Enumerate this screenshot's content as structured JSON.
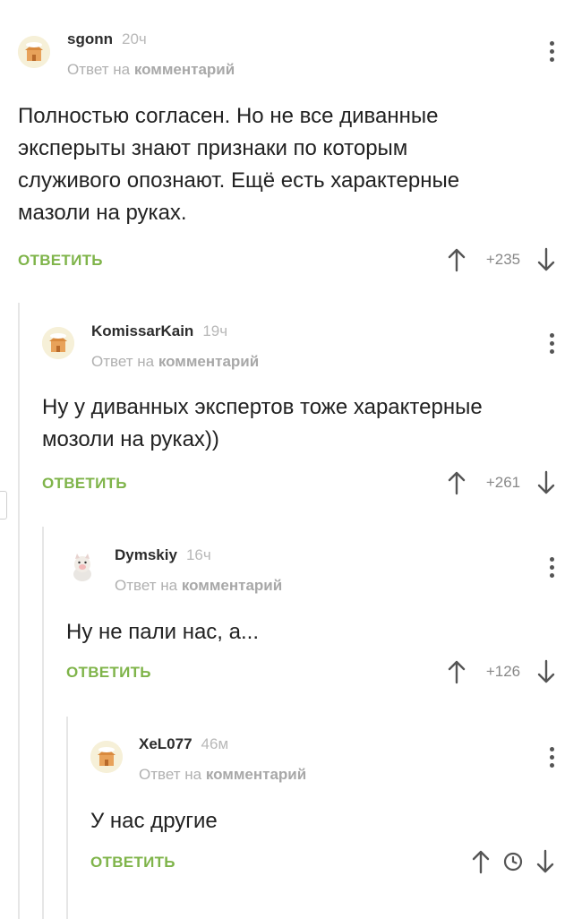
{
  "reply_label": "ОТВЕТИТЬ",
  "reply_to": {
    "prefix": "Ответ на",
    "target": "комментарий"
  },
  "colors": {
    "accent": "#7fb44a",
    "muted": "#b0b0b0",
    "text": "#222222"
  },
  "comments": [
    {
      "author": "sgonn",
      "time": "20ч",
      "avatar": "default-house-avatar",
      "text": "Полностью согласен. Но не все диванные\nэксперыты знают признаки по которым\nслуживого опознают. Ещё есть характерные\nмазоли на руках.",
      "score": "+235"
    },
    {
      "author": "KomissarKain",
      "time": "19ч",
      "avatar": "default-house-avatar",
      "text": "Ну у диванных экспертов тоже характерные\nмозоли на руках))",
      "score": "+261"
    },
    {
      "author": "Dymskiy",
      "time": "16ч",
      "avatar": "pig-toy-avatar",
      "text": "Ну не пали нас, а...",
      "score": "+126"
    },
    {
      "author": "XeL077",
      "time": "46м",
      "avatar": "default-house-avatar",
      "text": "У нас другие",
      "score": null,
      "score_icon": "clock-icon"
    }
  ]
}
